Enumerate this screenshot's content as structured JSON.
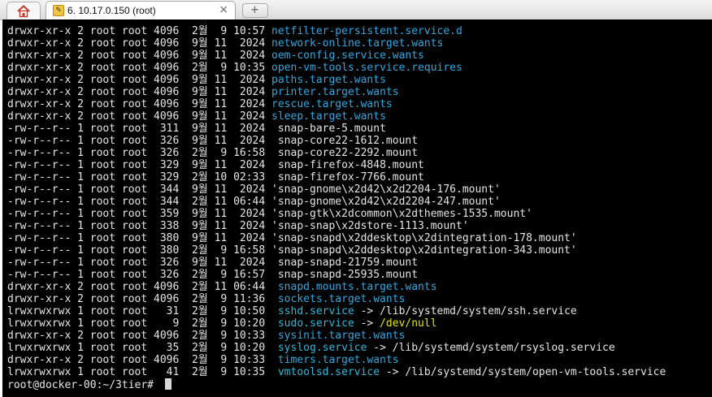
{
  "tabs": {
    "home_icon": "home-icon",
    "session_title": "6. 10.17.0.150 (root)",
    "close_glyph": "×",
    "new_tab_glyph": "+"
  },
  "terminal": {
    "colors": {
      "background": "#000000",
      "text": "#e5e5e5",
      "directory": "#2fa8e0",
      "symlink": "#2fb8d8",
      "dev": "#e5e500"
    },
    "lines": [
      {
        "meta": "drwxr-xr-x 2 root root 4096  2월  9 10:57 ",
        "name": "netfilter-persistent.service.d",
        "type": "dir"
      },
      {
        "meta": "drwxr-xr-x 2 root root 4096  9월 11  2024 ",
        "name": "network-online.target.wants",
        "type": "dir"
      },
      {
        "meta": "drwxr-xr-x 2 root root 4096  9월 11  2024 ",
        "name": "oem-config.service.wants",
        "type": "dir"
      },
      {
        "meta": "drwxr-xr-x 2 root root 4096  2월  9 10:35 ",
        "name": "open-vm-tools.service.requires",
        "type": "dir"
      },
      {
        "meta": "drwxr-xr-x 2 root root 4096  9월 11  2024 ",
        "name": "paths.target.wants",
        "type": "dir"
      },
      {
        "meta": "drwxr-xr-x 2 root root 4096  9월 11  2024 ",
        "name": "printer.target.wants",
        "type": "dir"
      },
      {
        "meta": "drwxr-xr-x 2 root root 4096  9월 11  2024 ",
        "name": "rescue.target.wants",
        "type": "dir"
      },
      {
        "meta": "drwxr-xr-x 2 root root 4096  9월 11  2024 ",
        "name": "sleep.target.wants",
        "type": "dir"
      },
      {
        "meta": "-rw-r--r-- 1 root root  311  9월 11  2024 ",
        "name": " snap-bare-5.mount",
        "type": "file"
      },
      {
        "meta": "-rw-r--r-- 1 root root  326  9월 11  2024 ",
        "name": " snap-core22-1612.mount",
        "type": "file"
      },
      {
        "meta": "-rw-r--r-- 1 root root  326  2월  9 16:58 ",
        "name": " snap-core22-2292.mount",
        "type": "file"
      },
      {
        "meta": "-rw-r--r-- 1 root root  329  9월 11  2024 ",
        "name": " snap-firefox-4848.mount",
        "type": "file"
      },
      {
        "meta": "-rw-r--r-- 1 root root  329  2월 10 02:33 ",
        "name": " snap-firefox-7766.mount",
        "type": "file"
      },
      {
        "meta": "-rw-r--r-- 1 root root  344  9월 11  2024 ",
        "name": "'snap-gnome\\x2d42\\x2d2204-176.mount'",
        "type": "file"
      },
      {
        "meta": "-rw-r--r-- 1 root root  344  2월 11 06:44 ",
        "name": "'snap-gnome\\x2d42\\x2d2204-247.mount'",
        "type": "file"
      },
      {
        "meta": "-rw-r--r-- 1 root root  359  9월 11  2024 ",
        "name": "'snap-gtk\\x2dcommon\\x2dthemes-1535.mount'",
        "type": "file"
      },
      {
        "meta": "-rw-r--r-- 1 root root  338  9월 11  2024 ",
        "name": "'snap-snap\\x2dstore-1113.mount'",
        "type": "file"
      },
      {
        "meta": "-rw-r--r-- 1 root root  380  9월 11  2024 ",
        "name": "'snap-snapd\\x2ddesktop\\x2dintegration-178.mount'",
        "type": "file"
      },
      {
        "meta": "-rw-r--r-- 1 root root  380  2월  9 16:58 ",
        "name": "'snap-snapd\\x2ddesktop\\x2dintegration-343.mount'",
        "type": "file"
      },
      {
        "meta": "-rw-r--r-- 1 root root  326  9월 11  2024 ",
        "name": " snap-snapd-21759.mount",
        "type": "file"
      },
      {
        "meta": "-rw-r--r-- 1 root root  326  2월  9 16:57 ",
        "name": " snap-snapd-25935.mount",
        "type": "file"
      },
      {
        "meta": "drwxr-xr-x 2 root root 4096  2월 11 06:44 ",
        "name": " snapd.mounts.target.wants",
        "type": "dir"
      },
      {
        "meta": "drwxr-xr-x 2 root root 4096  2월  9 11:36 ",
        "name": " sockets.target.wants",
        "type": "dir"
      },
      {
        "meta": "lrwxrwxrwx 1 root root   31  2월  9 10:50 ",
        "name": " sshd.service",
        "type": "link",
        "target": "/lib/systemd/system/ssh.service"
      },
      {
        "meta": "lrwxrwxrwx 1 root root    9  2월  9 10:20 ",
        "name": " sudo.service",
        "type": "link",
        "target": "/dev/null",
        "target_type": "dev"
      },
      {
        "meta": "drwxr-xr-x 2 root root 4096  2월  9 10:33 ",
        "name": " sysinit.target.wants",
        "type": "dir"
      },
      {
        "meta": "lrwxrwxrwx 1 root root   35  2월  9 10:20 ",
        "name": " syslog.service",
        "type": "link",
        "target": "/lib/systemd/system/rsyslog.service"
      },
      {
        "meta": "drwxr-xr-x 2 root root 4096  2월  9 10:33 ",
        "name": " timers.target.wants",
        "type": "dir"
      },
      {
        "meta": "lrwxrwxrwx 1 root root   41  2월  9 10:35 ",
        "name": " vmtoolsd.service",
        "type": "link",
        "target": "/lib/systemd/system/open-vm-tools.service"
      }
    ],
    "arrow": " -> ",
    "prompt": "root@docker-00:~/3tier# "
  }
}
